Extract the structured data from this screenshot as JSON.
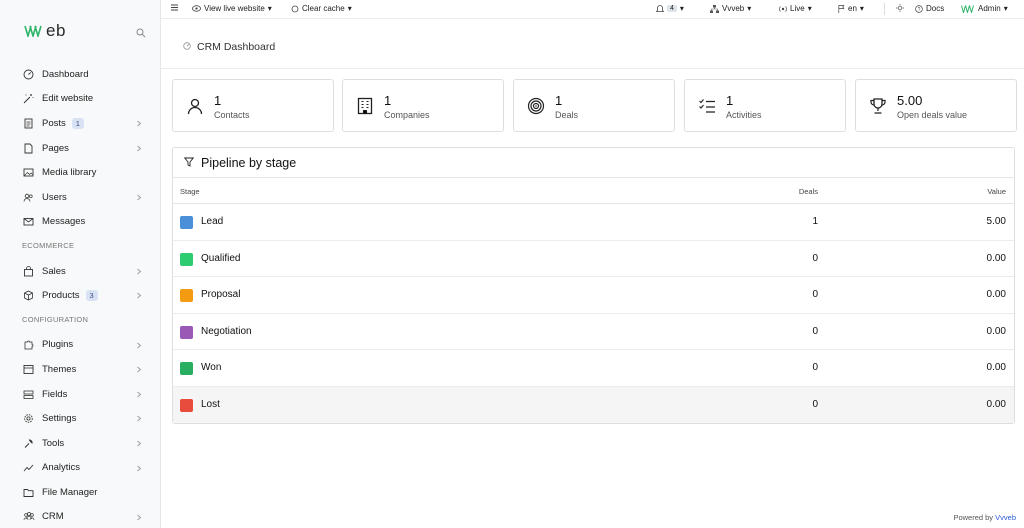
{
  "sidebar": {
    "logo": "\\\\\\veb",
    "items": [
      {
        "label": "Dashboard",
        "icon": "dashboard-icon"
      },
      {
        "label": "Edit website",
        "icon": "magic-wand-icon"
      },
      {
        "label": "Posts",
        "icon": "document-icon",
        "badge": "1",
        "chevron": true
      },
      {
        "label": "Pages",
        "icon": "page-icon",
        "chevron": true
      },
      {
        "label": "Media library",
        "icon": "image-icon"
      },
      {
        "label": "Users",
        "icon": "users-icon",
        "chevron": true
      },
      {
        "label": "Messages",
        "icon": "mail-icon"
      }
    ],
    "ecommerce_label": "ECOMMERCE",
    "ecommerce_items": [
      {
        "label": "Sales",
        "icon": "shopping-bag-icon",
        "chevron": true
      },
      {
        "label": "Products",
        "icon": "box-icon",
        "badge": "3",
        "chevron": true
      }
    ],
    "configuration_label": "CONFIGURATION",
    "configuration_items": [
      {
        "label": "Plugins",
        "icon": "puzzle-icon",
        "chevron": true
      },
      {
        "label": "Themes",
        "icon": "themes-icon",
        "chevron": true
      },
      {
        "label": "Fields",
        "icon": "fields-icon",
        "chevron": true
      },
      {
        "label": "Settings",
        "icon": "gear-icon",
        "chevron": true
      },
      {
        "label": "Tools",
        "icon": "wrench-icon",
        "chevron": true
      },
      {
        "label": "Analytics",
        "icon": "chart-line-icon",
        "chevron": true
      },
      {
        "label": "File Manager",
        "icon": "folder-icon"
      },
      {
        "label": "CRM",
        "icon": "crm-icon",
        "chevron": true
      }
    ]
  },
  "topbar": {
    "view_live": "View live website",
    "clear_cache": "Clear cache",
    "notifications": "4",
    "site": "Vvveb",
    "mode": "Live",
    "lang": "en",
    "docs": "Docs",
    "user": "Admin"
  },
  "page": {
    "title": "CRM Dashboard"
  },
  "stats": [
    {
      "value": "1",
      "label": "Contacts",
      "icon": "person-icon"
    },
    {
      "value": "1",
      "label": "Companies",
      "icon": "building-icon"
    },
    {
      "value": "1",
      "label": "Deals",
      "icon": "target-icon"
    },
    {
      "value": "1",
      "label": "Activities",
      "icon": "checklist-icon"
    },
    {
      "value": "5.00",
      "label": "Open deals value",
      "icon": "trophy-icon"
    }
  ],
  "pipeline": {
    "title": "Pipeline by stage",
    "columns": {
      "stage": "Stage",
      "deals": "Deals",
      "value": "Value"
    },
    "rows": [
      {
        "stage": "Lead",
        "deals": "1",
        "value": "5.00",
        "color": "#4a90d9"
      },
      {
        "stage": "Qualified",
        "deals": "0",
        "value": "0.00",
        "color": "#2ecc71"
      },
      {
        "stage": "Proposal",
        "deals": "0",
        "value": "0.00",
        "color": "#f39c12"
      },
      {
        "stage": "Negotiation",
        "deals": "0",
        "value": "0.00",
        "color": "#9b59b6"
      },
      {
        "stage": "Won",
        "deals": "0",
        "value": "0.00",
        "color": "#27ae60"
      },
      {
        "stage": "Lost",
        "deals": "0",
        "value": "0.00",
        "color": "#e74c3c"
      }
    ]
  },
  "footer": {
    "prefix": "Powered by",
    "brand": "Vvveb"
  }
}
